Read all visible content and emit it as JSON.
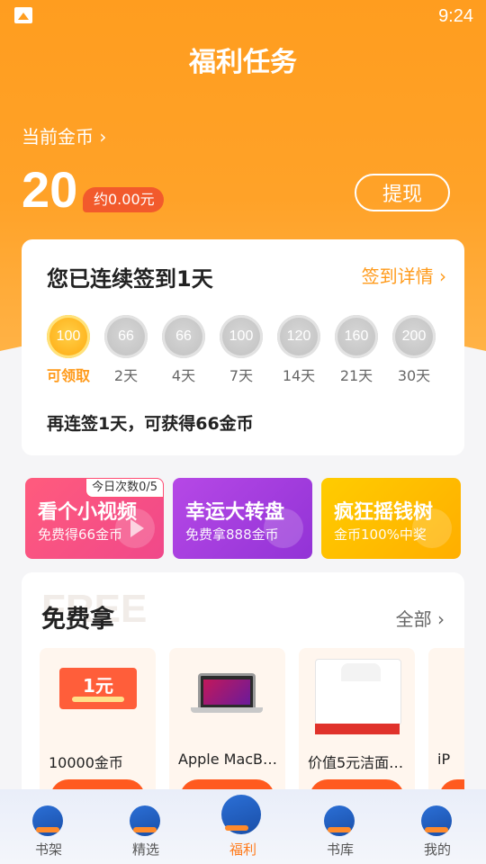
{
  "status_bar": {
    "time": "9:24"
  },
  "header": {
    "title": "福利任务",
    "coins_label": "当前金币",
    "coins_value": "20",
    "coins_approx": "约0.00元",
    "withdraw": "提现"
  },
  "signin": {
    "title": "您已连续签到1天",
    "detail_link": "签到详情",
    "days": [
      {
        "coins": "100",
        "label": "可领取",
        "active": true
      },
      {
        "coins": "66",
        "label": "2天"
      },
      {
        "coins": "66",
        "label": "4天"
      },
      {
        "coins": "100",
        "label": "7天"
      },
      {
        "coins": "120",
        "label": "14天"
      },
      {
        "coins": "160",
        "label": "21天"
      },
      {
        "coins": "200",
        "label": "30天"
      }
    ],
    "footer": "再连签1天，可获得66金币"
  },
  "promos": [
    {
      "title": "看个小视频",
      "subtitle": "免费得66金币",
      "badge": "今日次数0/5"
    },
    {
      "title": "幸运大转盘",
      "subtitle": "免费拿888金币"
    },
    {
      "title": "疯狂摇钱树",
      "subtitle": "金币100%中奖"
    }
  ],
  "free_section": {
    "ghost": "FREE",
    "title": "免费拿",
    "all_link": "全部",
    "products": [
      {
        "name": "10000金币",
        "voucher_amount": "1元"
      },
      {
        "name": "Apple MacB…"
      },
      {
        "name": "价值5元洁面…"
      },
      {
        "name": "iP"
      }
    ]
  },
  "bottom_nav": [
    {
      "label": "书架",
      "icon": "bookshelf-icon"
    },
    {
      "label": "精选",
      "icon": "featured-icon"
    },
    {
      "label": "福利",
      "icon": "welfare-icon",
      "active": true
    },
    {
      "label": "书库",
      "icon": "library-icon"
    },
    {
      "label": "我的",
      "icon": "profile-icon"
    }
  ],
  "colors": {
    "header_orange": "#ff9d1f",
    "accent": "#ff9a1a",
    "action_red": "#ff5a1f",
    "nav_active": "#ff7a1a"
  }
}
